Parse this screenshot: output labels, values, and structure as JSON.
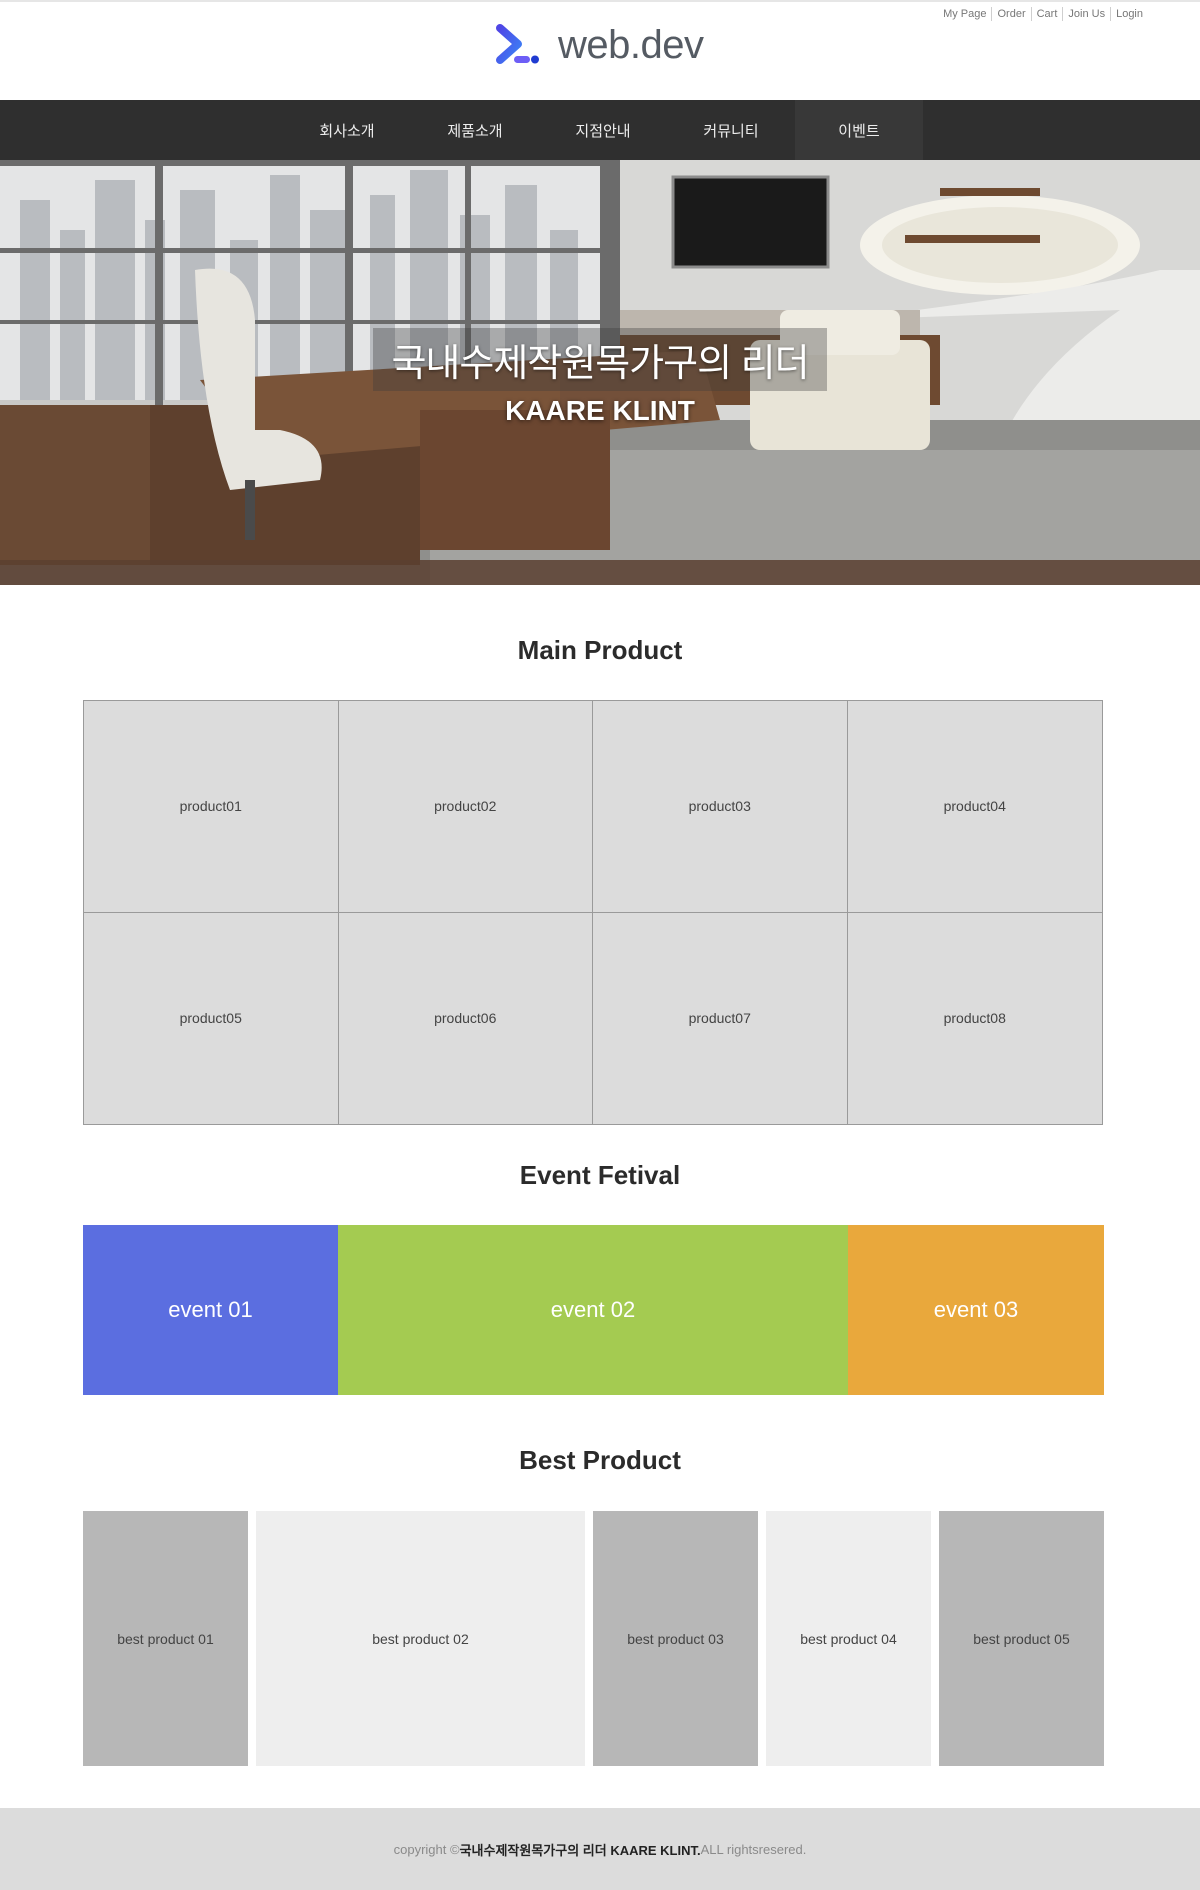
{
  "util_nav": [
    "My Page",
    "Order",
    "Cart",
    "Join Us",
    "Login"
  ],
  "logo": {
    "text": "web.dev",
    "icon": "web-dev-chevron-icon",
    "colors": [
      "#4f46e5",
      "#6d5ef6",
      "#3b82f6"
    ]
  },
  "nav": {
    "items": [
      "회사소개",
      "제품소개",
      "지점안내",
      "커뮤니티",
      "이벤트"
    ],
    "active_index": 4
  },
  "hero": {
    "title": "국내수제작원목가구의 리더",
    "subtitle": "KAARE KLINT"
  },
  "main_product": {
    "title": "Main Product",
    "items": [
      "product01",
      "product02",
      "product03",
      "product04",
      "product05",
      "product06",
      "product07",
      "product08"
    ]
  },
  "event": {
    "title": "Event Fetival",
    "items": [
      {
        "label": "event 01",
        "color": "#5b6ee0"
      },
      {
        "label": "event 02",
        "color": "#a4cb51"
      },
      {
        "label": "event 03",
        "color": "#e9a83c"
      }
    ]
  },
  "best_product": {
    "title": "Best Product",
    "items": [
      {
        "label": "best product 01",
        "color": "#b7b7b7"
      },
      {
        "label": "best product 02",
        "color": "#eeeeee"
      },
      {
        "label": "best product 03",
        "color": "#b7b7b7"
      },
      {
        "label": "best product 04",
        "color": "#eeeeee"
      },
      {
        "label": "best product 05",
        "color": "#b7b7b7"
      }
    ]
  },
  "footer": {
    "prefix": "copyright ©",
    "brand": "국내수제작원목가구의 리더 KAARE KLINT.",
    "suffix": " ALL rightsresered."
  },
  "colors": {
    "nav_bg": "#2f2f2f",
    "footer_bg": "#dcdcdc",
    "product_bg": "#dcdcdc"
  }
}
